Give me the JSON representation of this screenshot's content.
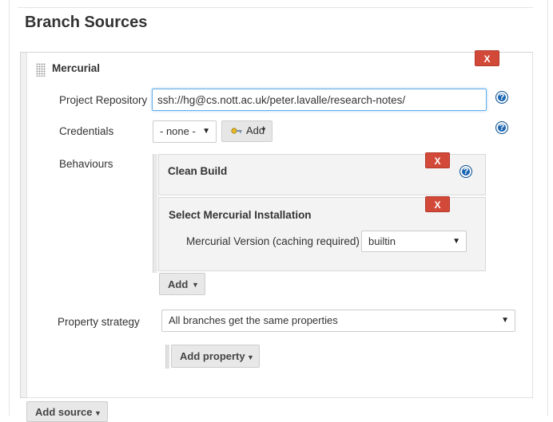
{
  "section": {
    "title": "Branch Sources"
  },
  "source": {
    "title": "Mercurial",
    "delete_label": "X",
    "fields": {
      "repository_label": "Project Repository",
      "repository_value": "ssh://hg@cs.nott.ac.uk/peter.lavalle/research-notes/",
      "credentials_label": "Credentials",
      "credentials_value": "- none -",
      "credentials_add_label": "Add",
      "behaviours_label": "Behaviours",
      "property_strategy_label": "Property strategy",
      "property_strategy_value": "All branches get the same properties"
    },
    "help_label": "?",
    "behaviours": [
      {
        "title": "Clean Build",
        "delete_label": "X"
      },
      {
        "title": "Select Mercurial Installation",
        "delete_label": "X",
        "field_label": "Mercurial Version (caching required)",
        "field_value": "builtin"
      }
    ],
    "behaviours_add_label": "Add",
    "add_property_label": "Add property"
  },
  "add_source_label": "Add source",
  "icons": {
    "drag": "drag-handle-icon",
    "help": "help-icon",
    "key": "key-icon",
    "caret": "caret-down-icon"
  },
  "colors": {
    "delete": "#d24939",
    "help": "#1a66b3",
    "input_focus": "#66afe9"
  }
}
